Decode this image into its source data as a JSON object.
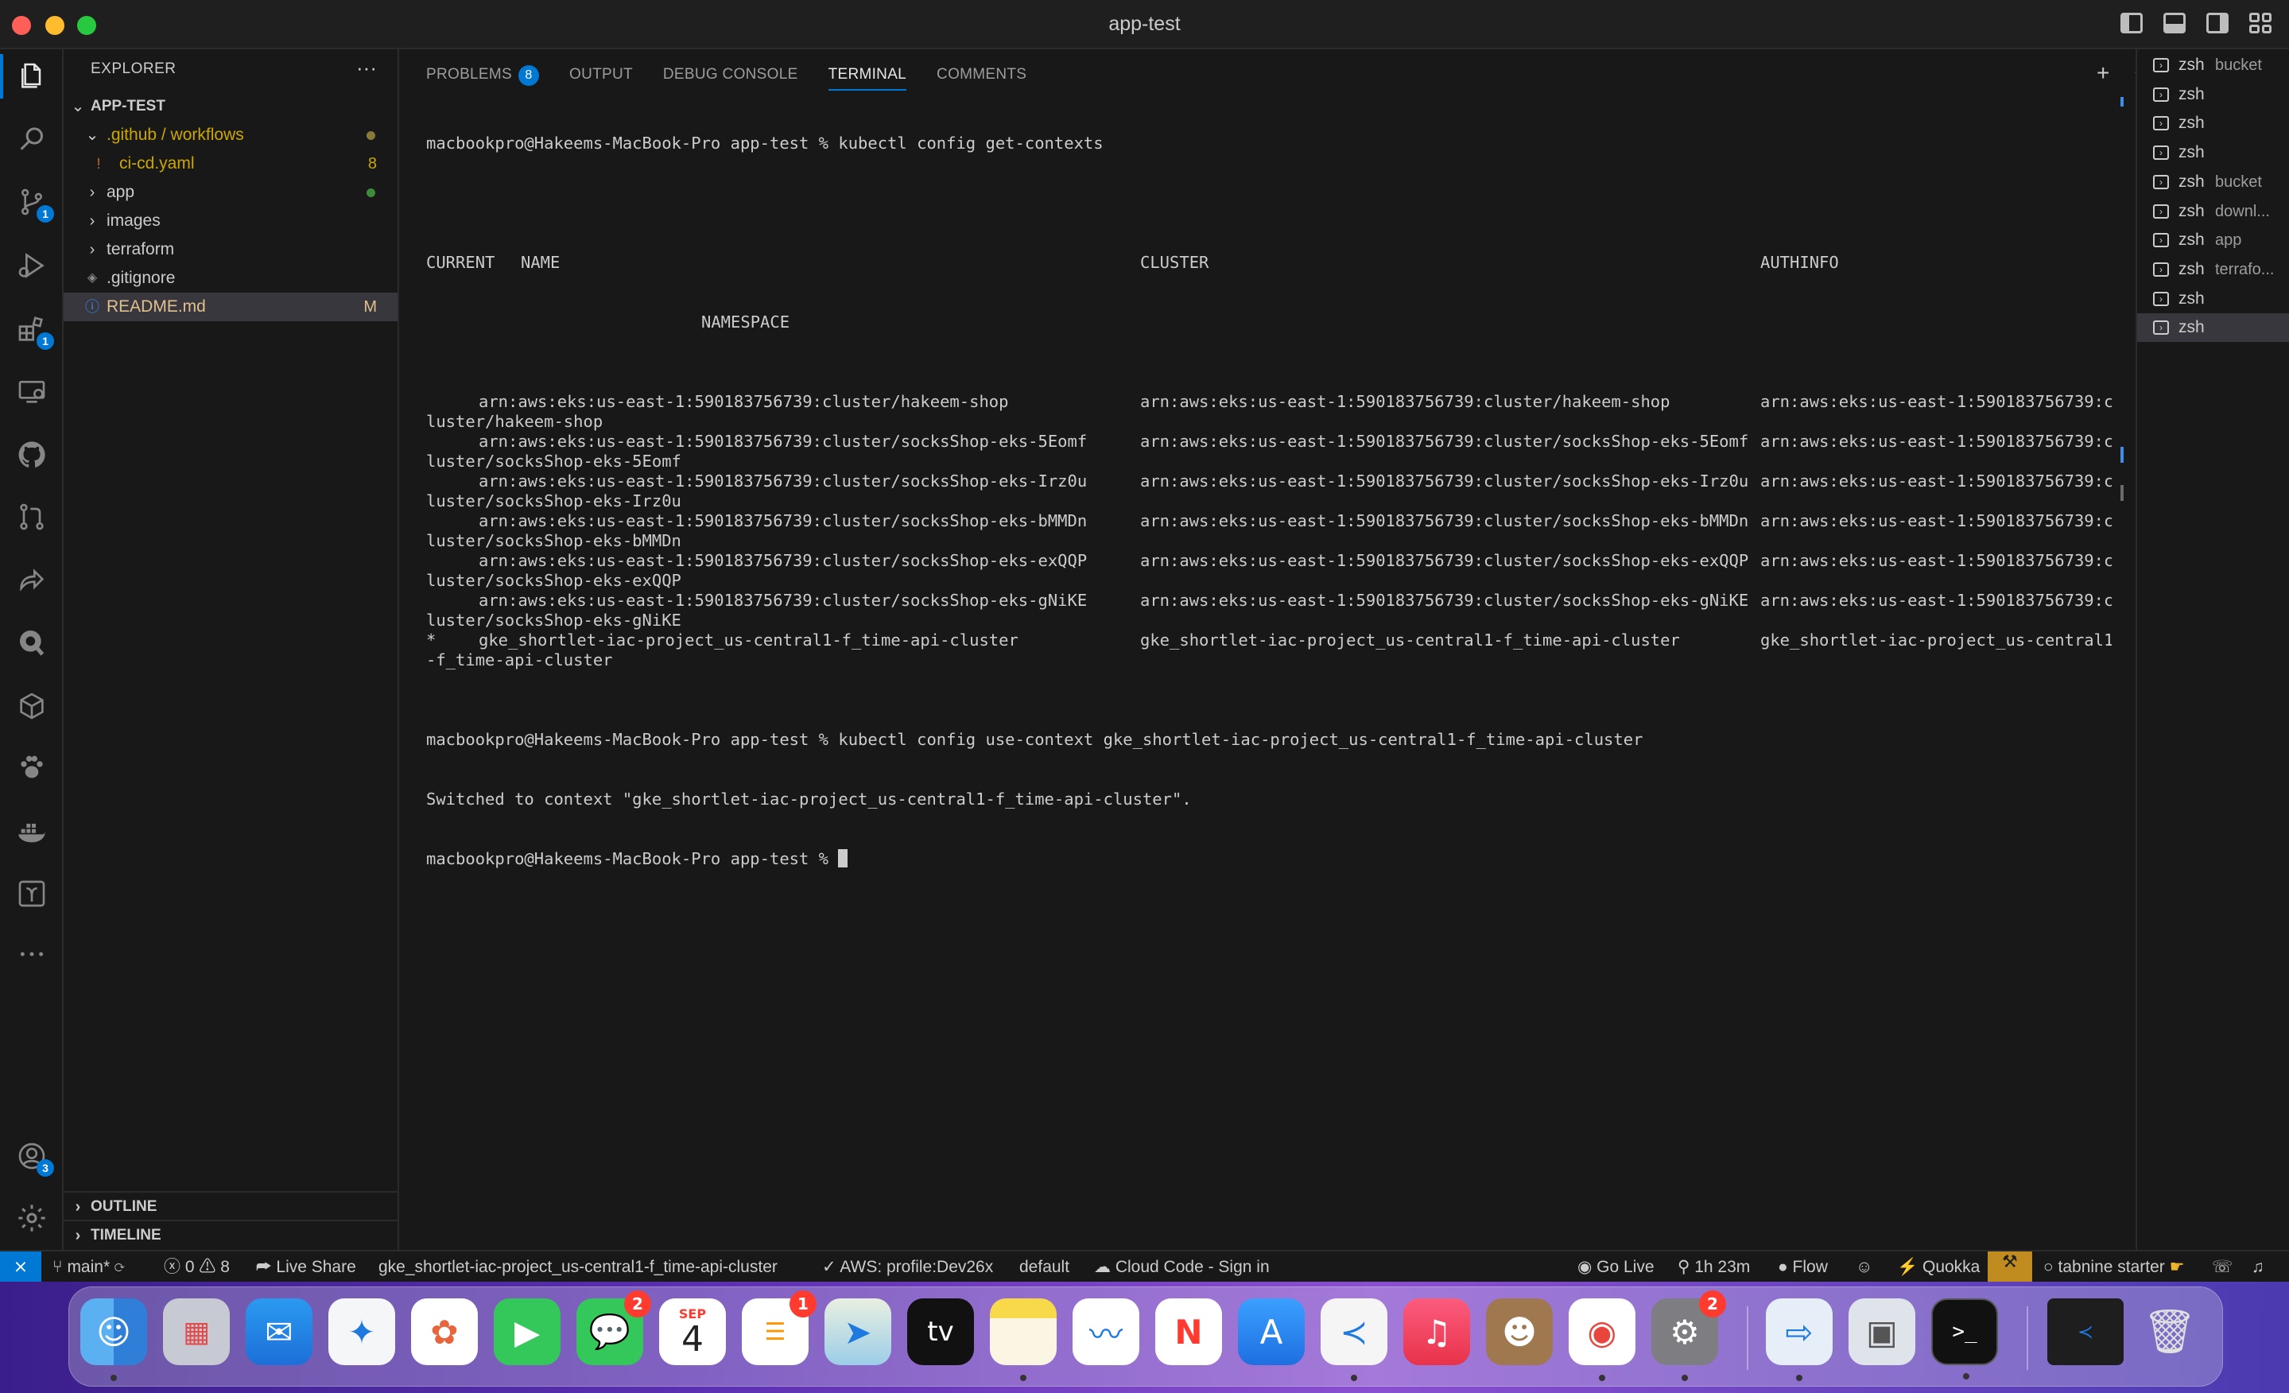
{
  "window": {
    "title": "app-test"
  },
  "activity_bar": {
    "source_control_badge": "1",
    "extensions_badge": "1",
    "accounts_badge": "3"
  },
  "explorer": {
    "title": "EXPLORER",
    "more": "···",
    "root": "APP-TEST",
    "items": [
      {
        "label": ".github / workflows",
        "color": "#cca700"
      },
      {
        "label": "ci-cd.yaml",
        "badge": "8",
        "color": "#cca700"
      },
      {
        "label": "app",
        "color": "#cccccc"
      },
      {
        "label": "images",
        "color": "#cccccc"
      },
      {
        "label": "terraform",
        "color": "#cccccc"
      },
      {
        "label": ".gitignore",
        "color": "#8b8b8b"
      },
      {
        "label": "README.md",
        "badge": "M",
        "color": "#e2c08d"
      }
    ],
    "outline": "OUTLINE",
    "timeline": "TIMELINE"
  },
  "panel": {
    "tabs": [
      {
        "label": "PROBLEMS",
        "badge": "8"
      },
      {
        "label": "OUTPUT"
      },
      {
        "label": "DEBUG CONSOLE"
      },
      {
        "label": "TERMINAL"
      },
      {
        "label": "COMMENTS"
      }
    ],
    "actions": [
      "+",
      "⌄",
      "···",
      "⌄",
      "✕"
    ]
  },
  "terminal": {
    "prompt1": "macbookpro@Hakeems-MacBook-Pro app-test % kubectl config get-contexts",
    "header": {
      "current": "CURRENT",
      "name": "NAME",
      "cluster": "CLUSTER",
      "authinfo": "AUTHINFO",
      "namespace": "NAMESPACE"
    },
    "rows": [
      {
        "current": "",
        "name": "arn:aws:eks:us-east-1:590183756739:cluster/hakeem-shop",
        "cluster": "arn:aws:eks:us-east-1:590183756739:cluster/hakeem-shop",
        "authinfo": "arn:aws:eks:us-east-1:590183756739:c",
        "wrap": "luster/hakeem-shop"
      },
      {
        "current": "",
        "name": "arn:aws:eks:us-east-1:590183756739:cluster/socksShop-eks-5Eomf",
        "cluster": "arn:aws:eks:us-east-1:590183756739:cluster/socksShop-eks-5Eomf",
        "authinfo": "arn:aws:eks:us-east-1:590183756739:c",
        "wrap": "luster/socksShop-eks-5Eomf"
      },
      {
        "current": "",
        "name": "arn:aws:eks:us-east-1:590183756739:cluster/socksShop-eks-Irz0u",
        "cluster": "arn:aws:eks:us-east-1:590183756739:cluster/socksShop-eks-Irz0u",
        "authinfo": "arn:aws:eks:us-east-1:590183756739:c",
        "wrap": "luster/socksShop-eks-Irz0u"
      },
      {
        "current": "",
        "name": "arn:aws:eks:us-east-1:590183756739:cluster/socksShop-eks-bMMDn",
        "cluster": "arn:aws:eks:us-east-1:590183756739:cluster/socksShop-eks-bMMDn",
        "authinfo": "arn:aws:eks:us-east-1:590183756739:c",
        "wrap": "luster/socksShop-eks-bMMDn"
      },
      {
        "current": "",
        "name": "arn:aws:eks:us-east-1:590183756739:cluster/socksShop-eks-exQQP",
        "cluster": "arn:aws:eks:us-east-1:590183756739:cluster/socksShop-eks-exQQP",
        "authinfo": "arn:aws:eks:us-east-1:590183756739:c",
        "wrap": "luster/socksShop-eks-exQQP"
      },
      {
        "current": "",
        "name": "arn:aws:eks:us-east-1:590183756739:cluster/socksShop-eks-gNiKE",
        "cluster": "arn:aws:eks:us-east-1:590183756739:cluster/socksShop-eks-gNiKE",
        "authinfo": "arn:aws:eks:us-east-1:590183756739:c",
        "wrap": "luster/socksShop-eks-gNiKE"
      },
      {
        "current": "*",
        "name": "gke_shortlet-iac-project_us-central1-f_time-api-cluster",
        "cluster": "gke_shortlet-iac-project_us-central1-f_time-api-cluster",
        "authinfo": "gke_shortlet-iac-project_us-central1",
        "wrap": "-f_time-api-cluster"
      }
    ],
    "prompt2": "macbookpro@Hakeems-MacBook-Pro app-test % kubectl config use-context gke_shortlet-iac-project_us-central1-f_time-api-cluster",
    "output2": "Switched to context \"gke_shortlet-iac-project_us-central1-f_time-api-cluster\".",
    "prompt3": "macbookpro@Hakeems-MacBook-Pro app-test % "
  },
  "terminal_list": [
    {
      "name": "zsh",
      "desc": "bucket"
    },
    {
      "name": "zsh",
      "desc": ""
    },
    {
      "name": "zsh",
      "desc": ""
    },
    {
      "name": "zsh",
      "desc": ""
    },
    {
      "name": "zsh",
      "desc": "bucket"
    },
    {
      "name": "zsh",
      "desc": "downl..."
    },
    {
      "name": "zsh",
      "desc": "app"
    },
    {
      "name": "zsh",
      "desc": "terrafo..."
    },
    {
      "name": "zsh",
      "desc": ""
    },
    {
      "name": "zsh",
      "desc": ""
    }
  ],
  "status_bar": {
    "remote": "⨯",
    "branch": "main*",
    "sync": "⟳",
    "errors": "0",
    "warnings": "8",
    "live_share": "Live Share",
    "context": "gke_shortlet-iac-project_us-central1-f_time-api-cluster",
    "aws": "AWS: profile:Dev26x",
    "default": "default",
    "cloud_code": "Cloud Code - Sign in",
    "go_live": "Go Live",
    "timer": "1h 23m",
    "flow": "Flow",
    "quokka": "Quokka",
    "tabnine": "tabnine starter"
  },
  "dock": {
    "calendar_month": "SEP",
    "calendar_day": "4",
    "messages_badge": "2",
    "reminders_badge": "1",
    "settings_badge": "2",
    "appletv_label": "tv"
  },
  "colors": {
    "accent": "#0078d4",
    "modified": "#e2c08d",
    "git_dot": "#8a7a3a",
    "git_dot_green": "#3c8a3a"
  }
}
